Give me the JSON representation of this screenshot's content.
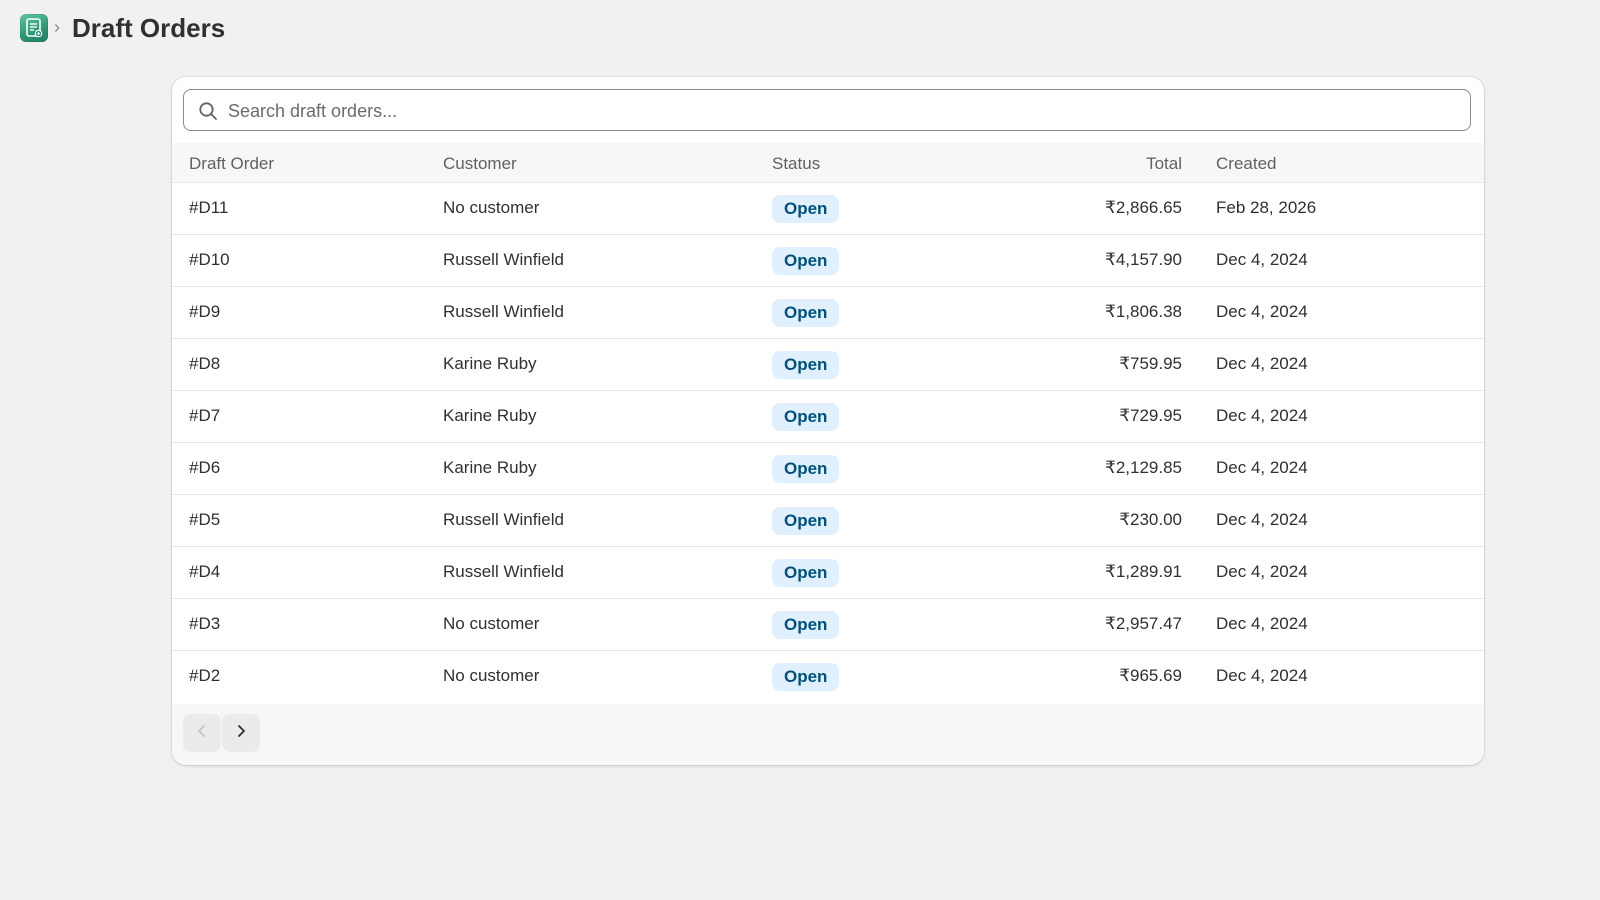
{
  "header": {
    "breadcrumb_separator": "›",
    "title": "Draft Orders"
  },
  "search": {
    "placeholder": "Search draft orders..."
  },
  "table": {
    "columns": [
      "Draft Order",
      "Customer",
      "Status",
      "Total",
      "Created"
    ],
    "rows": [
      {
        "order": "#D11",
        "customer": "No customer",
        "status": "Open",
        "total": "₹2,866.65",
        "created": "Feb 28, 2026"
      },
      {
        "order": "#D10",
        "customer": "Russell Winfield",
        "status": "Open",
        "total": "₹4,157.90",
        "created": "Dec 4, 2024"
      },
      {
        "order": "#D9",
        "customer": "Russell Winfield",
        "status": "Open",
        "total": "₹1,806.38",
        "created": "Dec 4, 2024"
      },
      {
        "order": "#D8",
        "customer": "Karine Ruby",
        "status": "Open",
        "total": "₹759.95",
        "created": "Dec 4, 2024"
      },
      {
        "order": "#D7",
        "customer": "Karine Ruby",
        "status": "Open",
        "total": "₹729.95",
        "created": "Dec 4, 2024"
      },
      {
        "order": "#D6",
        "customer": "Karine Ruby",
        "status": "Open",
        "total": "₹2,129.85",
        "created": "Dec 4, 2024"
      },
      {
        "order": "#D5",
        "customer": "Russell Winfield",
        "status": "Open",
        "total": "₹230.00",
        "created": "Dec 4, 2024"
      },
      {
        "order": "#D4",
        "customer": "Russell Winfield",
        "status": "Open",
        "total": "₹1,289.91",
        "created": "Dec 4, 2024"
      },
      {
        "order": "#D3",
        "customer": "No customer",
        "status": "Open",
        "total": "₹2,957.47",
        "created": "Dec 4, 2024"
      },
      {
        "order": "#D2",
        "customer": "No customer",
        "status": "Open",
        "total": "₹965.69",
        "created": "Dec 4, 2024"
      }
    ]
  },
  "pagination": {
    "prev_icon": "chevron-left-icon",
    "next_icon": "chevron-right-icon",
    "prev_enabled": false,
    "next_enabled": true
  },
  "colors": {
    "page_bg": "#f1f1f1",
    "badge_bg": "#e0f0ff",
    "badge_text": "#00527c",
    "app_icon": "#2f9c78"
  }
}
